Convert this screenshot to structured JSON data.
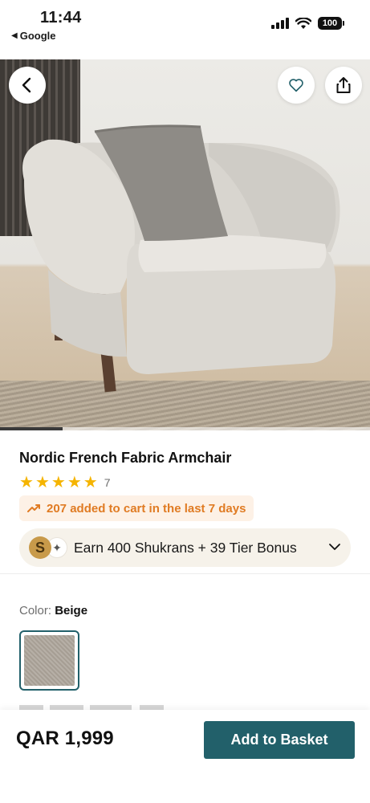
{
  "status_bar": {
    "time": "11:44",
    "back_app": "Google",
    "battery": "100"
  },
  "hero": {
    "image_alt": "armchair-photo",
    "gallery_progress": 0.17
  },
  "product": {
    "title": "Nordic French Fabric Armchair",
    "rating_stars": 5,
    "rating_count": "7",
    "cart_notice": "207 added to cart in the last 7 days",
    "shukran": {
      "coin_letter": "S",
      "text": "Earn 400 Shukrans + 39 Tier Bonus"
    },
    "color": {
      "label": "Color:",
      "value": "Beige"
    }
  },
  "bottom_bar": {
    "price": "QAR 1,999",
    "add_button": "Add to Basket"
  },
  "colors": {
    "accent": "#22606a",
    "star": "#f5b400",
    "cart_text": "#e07b23",
    "cart_bg": "#fdf1e6"
  }
}
